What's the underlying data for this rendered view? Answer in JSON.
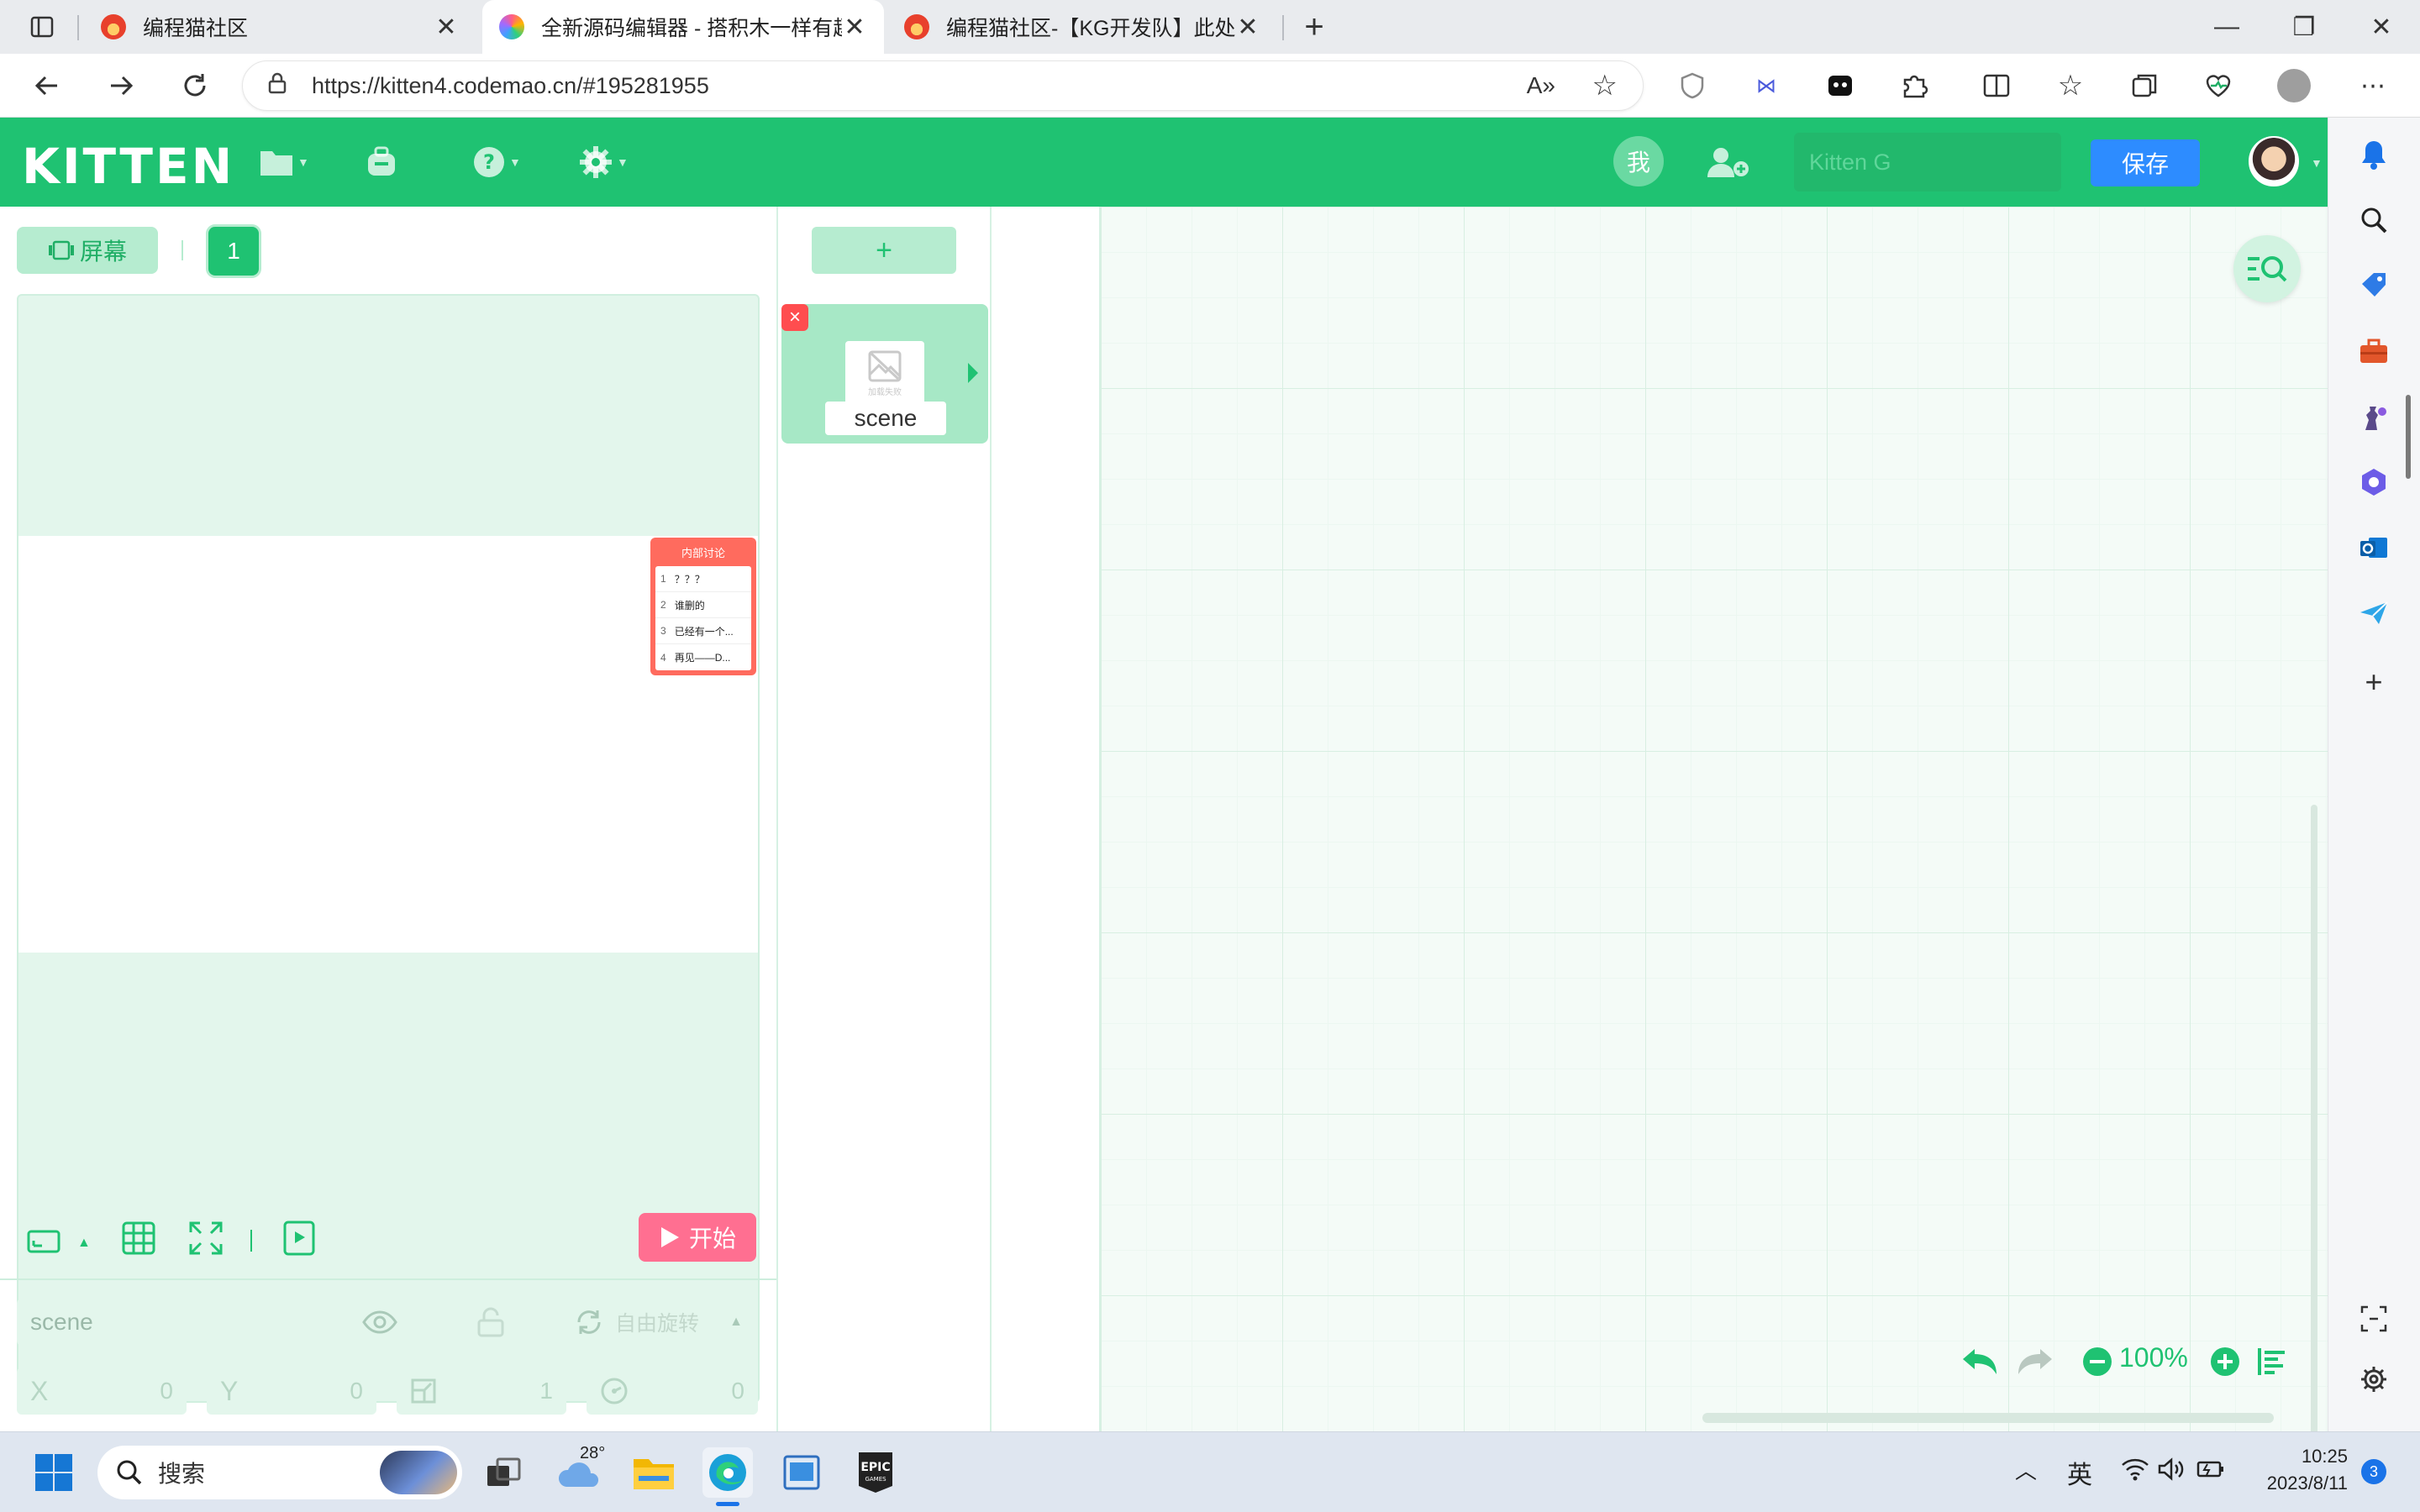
{
  "browser": {
    "tabs": [
      {
        "title": "编程猫社区",
        "active": false
      },
      {
        "title": "全新源码编辑器 - 搭积木一样有趣",
        "active": true
      },
      {
        "title": "编程猫社区-【KG开发队】此处无",
        "active": false
      }
    ],
    "new_tab": "+",
    "url": "https://kitten4.codemao.cn/#195281955",
    "window_controls": {
      "minimize": "—",
      "restore": "❐",
      "close": "✕"
    }
  },
  "app": {
    "logo": "KITTEN",
    "me_label": "我",
    "search_placeholder": "Kitten G",
    "save_label": "保存",
    "accent": "#1fc272",
    "save_color": "#2d8cff"
  },
  "stage": {
    "screen_label": "屏幕",
    "page_number": "1",
    "start_label": "开始",
    "discuss": {
      "title": "内部讨论",
      "rows": [
        {
          "num": "1",
          "text": "？？？"
        },
        {
          "num": "2",
          "text": "谁删的"
        },
        {
          "num": "3",
          "text": "已经有一个..."
        },
        {
          "num": "4",
          "text": "再见——D..."
        }
      ]
    }
  },
  "props": {
    "name_value": "scene",
    "rotate_label": "自由旋转",
    "x_label": "X",
    "x_value": "0",
    "y_label": "Y",
    "y_value": "0",
    "scale_value": "1",
    "direction_value": "0"
  },
  "sprites": {
    "add_label": "+",
    "items": [
      {
        "name": "scene",
        "image_text": "加载失败"
      }
    ]
  },
  "workspace": {
    "zoom": "100%"
  },
  "taskbar": {
    "search_label": "搜索",
    "weather": "28°",
    "ime": "英",
    "time": "10:25",
    "date": "2023/8/11",
    "notifications": "3"
  }
}
